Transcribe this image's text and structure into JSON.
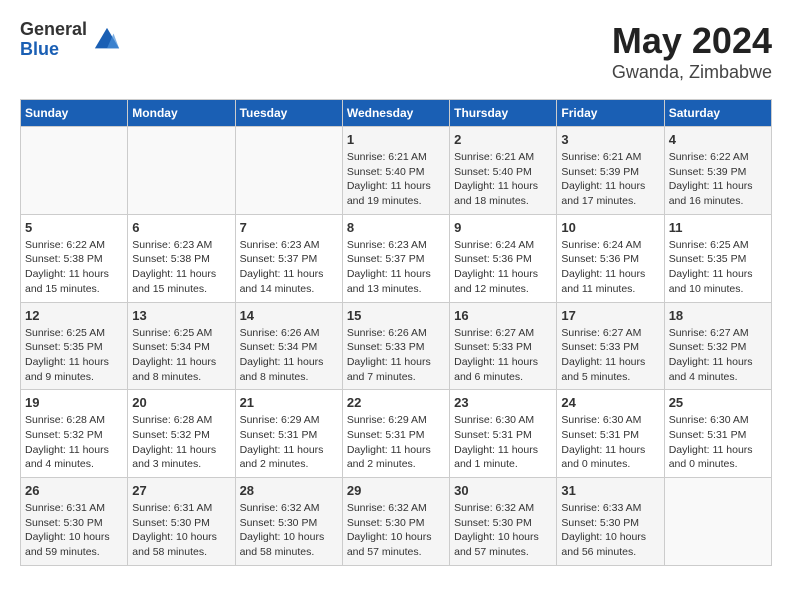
{
  "header": {
    "logo_general": "General",
    "logo_blue": "Blue",
    "month_title": "May 2024",
    "location": "Gwanda, Zimbabwe"
  },
  "days_of_week": [
    "Sunday",
    "Monday",
    "Tuesday",
    "Wednesday",
    "Thursday",
    "Friday",
    "Saturday"
  ],
  "weeks": [
    [
      {
        "day": "",
        "info": ""
      },
      {
        "day": "",
        "info": ""
      },
      {
        "day": "",
        "info": ""
      },
      {
        "day": "1",
        "info": "Sunrise: 6:21 AM\nSunset: 5:40 PM\nDaylight: 11 hours and 19 minutes."
      },
      {
        "day": "2",
        "info": "Sunrise: 6:21 AM\nSunset: 5:40 PM\nDaylight: 11 hours and 18 minutes."
      },
      {
        "day": "3",
        "info": "Sunrise: 6:21 AM\nSunset: 5:39 PM\nDaylight: 11 hours and 17 minutes."
      },
      {
        "day": "4",
        "info": "Sunrise: 6:22 AM\nSunset: 5:39 PM\nDaylight: 11 hours and 16 minutes."
      }
    ],
    [
      {
        "day": "5",
        "info": "Sunrise: 6:22 AM\nSunset: 5:38 PM\nDaylight: 11 hours and 15 minutes."
      },
      {
        "day": "6",
        "info": "Sunrise: 6:23 AM\nSunset: 5:38 PM\nDaylight: 11 hours and 15 minutes."
      },
      {
        "day": "7",
        "info": "Sunrise: 6:23 AM\nSunset: 5:37 PM\nDaylight: 11 hours and 14 minutes."
      },
      {
        "day": "8",
        "info": "Sunrise: 6:23 AM\nSunset: 5:37 PM\nDaylight: 11 hours and 13 minutes."
      },
      {
        "day": "9",
        "info": "Sunrise: 6:24 AM\nSunset: 5:36 PM\nDaylight: 11 hours and 12 minutes."
      },
      {
        "day": "10",
        "info": "Sunrise: 6:24 AM\nSunset: 5:36 PM\nDaylight: 11 hours and 11 minutes."
      },
      {
        "day": "11",
        "info": "Sunrise: 6:25 AM\nSunset: 5:35 PM\nDaylight: 11 hours and 10 minutes."
      }
    ],
    [
      {
        "day": "12",
        "info": "Sunrise: 6:25 AM\nSunset: 5:35 PM\nDaylight: 11 hours and 9 minutes."
      },
      {
        "day": "13",
        "info": "Sunrise: 6:25 AM\nSunset: 5:34 PM\nDaylight: 11 hours and 8 minutes."
      },
      {
        "day": "14",
        "info": "Sunrise: 6:26 AM\nSunset: 5:34 PM\nDaylight: 11 hours and 8 minutes."
      },
      {
        "day": "15",
        "info": "Sunrise: 6:26 AM\nSunset: 5:33 PM\nDaylight: 11 hours and 7 minutes."
      },
      {
        "day": "16",
        "info": "Sunrise: 6:27 AM\nSunset: 5:33 PM\nDaylight: 11 hours and 6 minutes."
      },
      {
        "day": "17",
        "info": "Sunrise: 6:27 AM\nSunset: 5:33 PM\nDaylight: 11 hours and 5 minutes."
      },
      {
        "day": "18",
        "info": "Sunrise: 6:27 AM\nSunset: 5:32 PM\nDaylight: 11 hours and 4 minutes."
      }
    ],
    [
      {
        "day": "19",
        "info": "Sunrise: 6:28 AM\nSunset: 5:32 PM\nDaylight: 11 hours and 4 minutes."
      },
      {
        "day": "20",
        "info": "Sunrise: 6:28 AM\nSunset: 5:32 PM\nDaylight: 11 hours and 3 minutes."
      },
      {
        "day": "21",
        "info": "Sunrise: 6:29 AM\nSunset: 5:31 PM\nDaylight: 11 hours and 2 minutes."
      },
      {
        "day": "22",
        "info": "Sunrise: 6:29 AM\nSunset: 5:31 PM\nDaylight: 11 hours and 2 minutes."
      },
      {
        "day": "23",
        "info": "Sunrise: 6:30 AM\nSunset: 5:31 PM\nDaylight: 11 hours and 1 minute."
      },
      {
        "day": "24",
        "info": "Sunrise: 6:30 AM\nSunset: 5:31 PM\nDaylight: 11 hours and 0 minutes."
      },
      {
        "day": "25",
        "info": "Sunrise: 6:30 AM\nSunset: 5:31 PM\nDaylight: 11 hours and 0 minutes."
      }
    ],
    [
      {
        "day": "26",
        "info": "Sunrise: 6:31 AM\nSunset: 5:30 PM\nDaylight: 10 hours and 59 minutes."
      },
      {
        "day": "27",
        "info": "Sunrise: 6:31 AM\nSunset: 5:30 PM\nDaylight: 10 hours and 58 minutes."
      },
      {
        "day": "28",
        "info": "Sunrise: 6:32 AM\nSunset: 5:30 PM\nDaylight: 10 hours and 58 minutes."
      },
      {
        "day": "29",
        "info": "Sunrise: 6:32 AM\nSunset: 5:30 PM\nDaylight: 10 hours and 57 minutes."
      },
      {
        "day": "30",
        "info": "Sunrise: 6:32 AM\nSunset: 5:30 PM\nDaylight: 10 hours and 57 minutes."
      },
      {
        "day": "31",
        "info": "Sunrise: 6:33 AM\nSunset: 5:30 PM\nDaylight: 10 hours and 56 minutes."
      },
      {
        "day": "",
        "info": ""
      }
    ]
  ]
}
